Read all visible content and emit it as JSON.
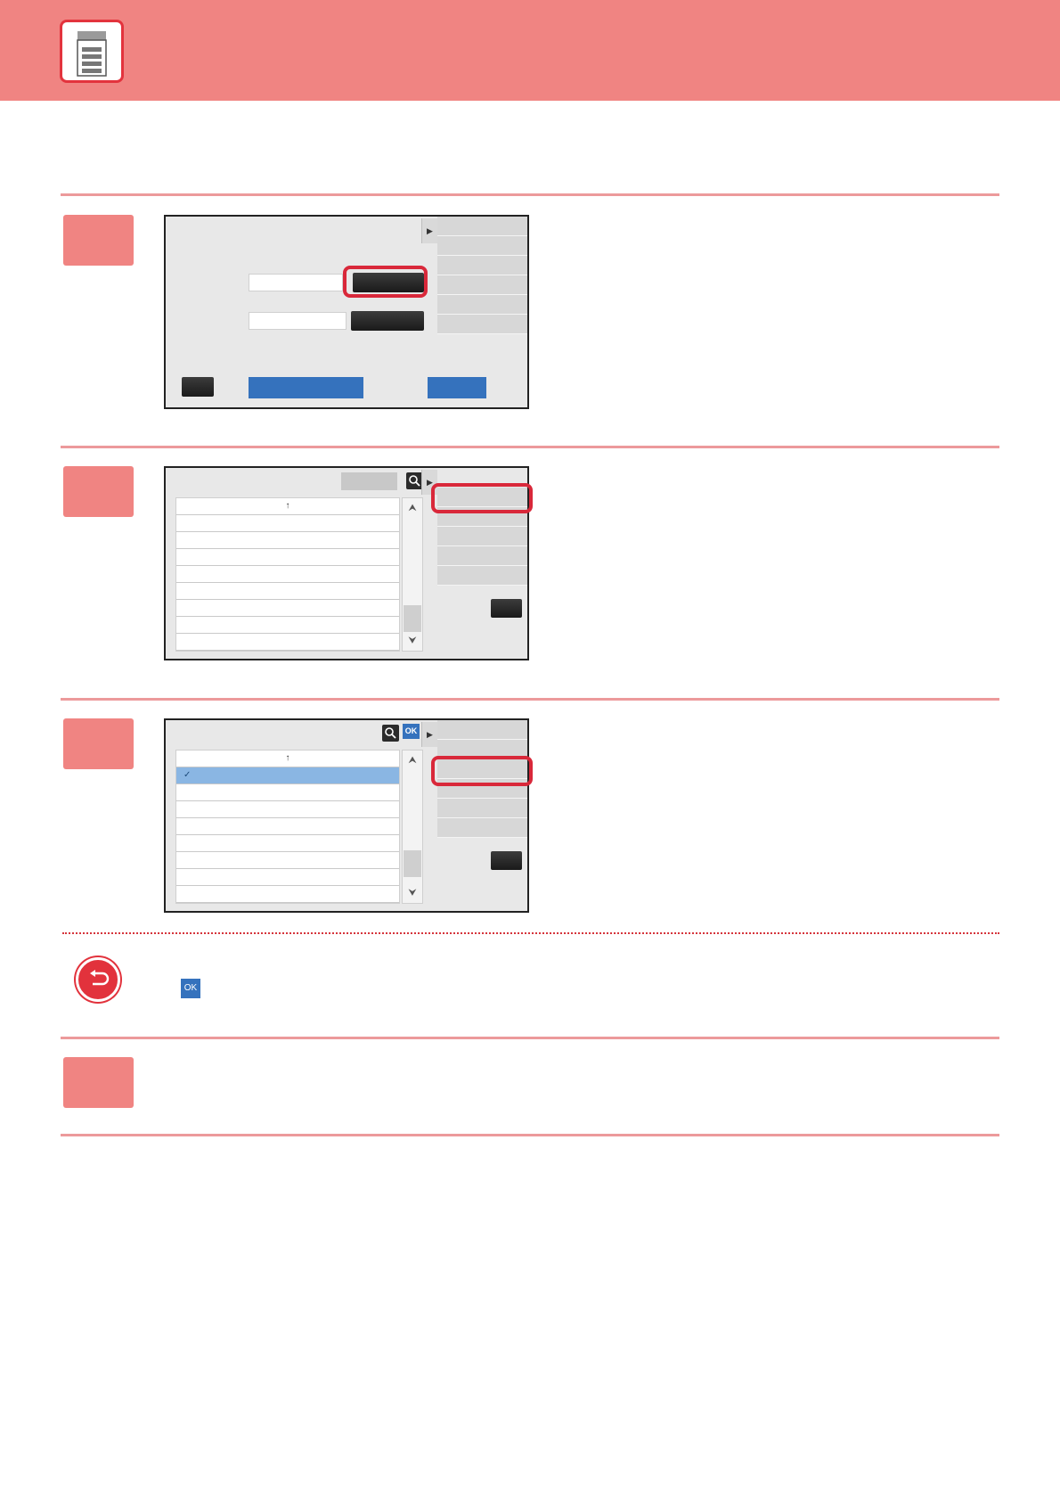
{
  "header": {
    "icon": "copier-icon"
  },
  "screens": {
    "list_header_arrow": "↑",
    "selected_check": "✓",
    "scroll_up_icon": "⮝",
    "scroll_down_icon": "⮟",
    "panel_toggle_icon": "▶",
    "ok_label": "OK"
  },
  "note": {
    "icon": "back-arrow-icon",
    "ok_label": "OK"
  },
  "colors": {
    "accent": "#f08482",
    "highlight": "#d9283a",
    "blue": "#3572bd"
  }
}
